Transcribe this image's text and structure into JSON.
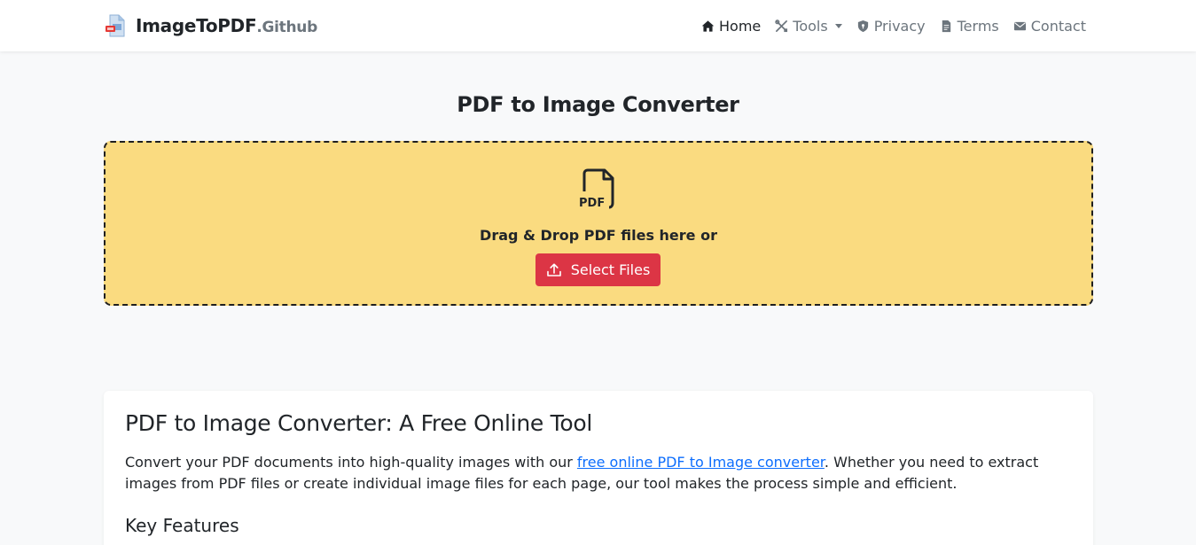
{
  "brand": {
    "name": "ImageToPDF",
    "suffix": ".Github"
  },
  "nav": {
    "items": [
      {
        "label": "Home",
        "icon": "home-icon",
        "active": true
      },
      {
        "label": "Tools",
        "icon": "tools-icon",
        "dropdown": true
      },
      {
        "label": "Privacy",
        "icon": "shield-icon"
      },
      {
        "label": "Terms",
        "icon": "document-icon"
      },
      {
        "label": "Contact",
        "icon": "envelope-icon"
      }
    ]
  },
  "main": {
    "title": "PDF to Image Converter",
    "dropzone": {
      "icon": "pdf-file-icon",
      "icon_text": "PDF",
      "text": "Drag & Drop PDF files here or",
      "button_label": "Select Files",
      "button_icon": "upload-icon"
    }
  },
  "info": {
    "title": "PDF to Image Converter: A Free Online Tool",
    "para_before": "Convert your PDF documents into high-quality images with our ",
    "link_text": "free online PDF to Image converter",
    "para_after": ". Whether you need to extract images from PDF files or create individual image files for each page, our tool makes the process simple and efficient.",
    "features_heading": "Key Features"
  },
  "colors": {
    "dropzone_bg": "#fadb80",
    "button_bg": "#dc3545",
    "link": "#0d6efd",
    "page_bg": "#f8f9fa"
  }
}
